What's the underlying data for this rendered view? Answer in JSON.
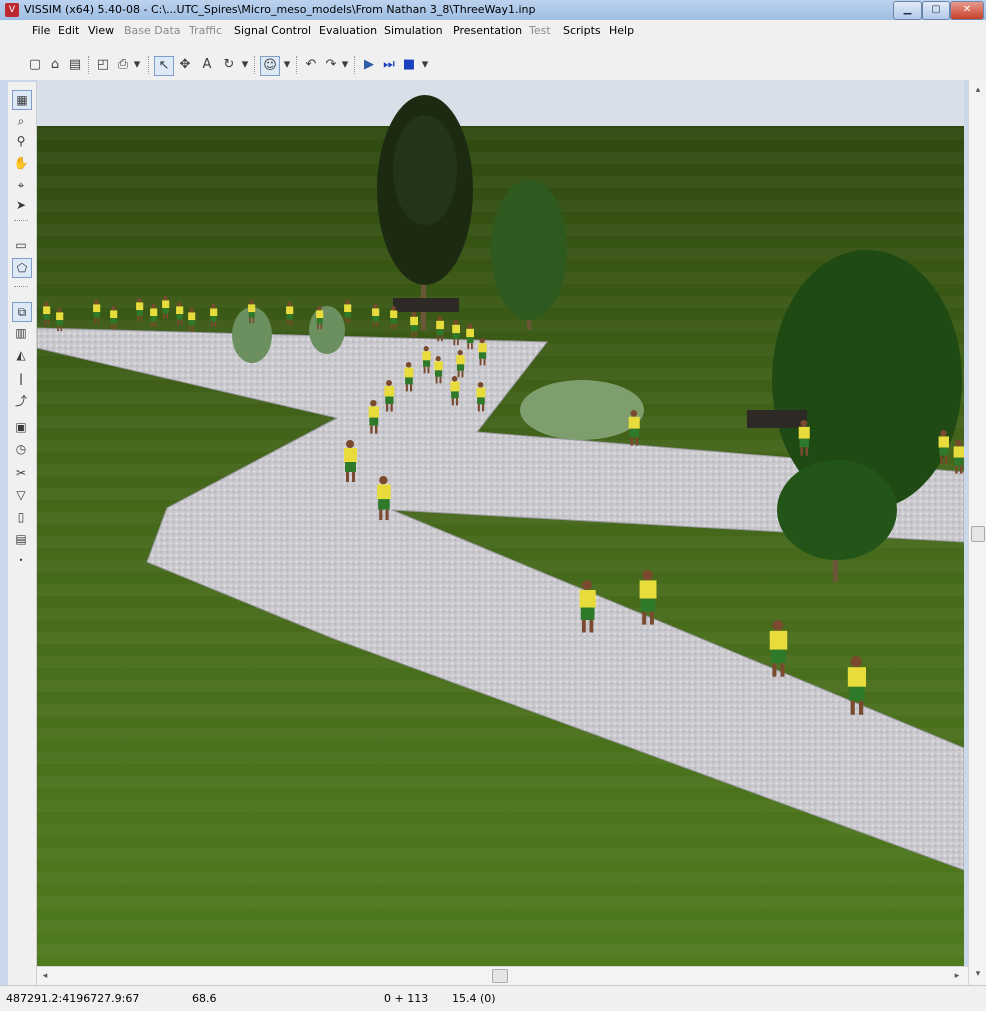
{
  "window": {
    "title": "VISSIM (x64) 5.40-08 - C:\\...UTC_Spires\\Micro_meso_models\\From Nathan 3_8\\ThreeWay1.inp",
    "controls": [
      "minimize",
      "maximize",
      "close"
    ]
  },
  "menu": [
    {
      "label": "File",
      "enabled": true
    },
    {
      "label": "Edit",
      "enabled": true
    },
    {
      "label": "View",
      "enabled": true
    },
    {
      "label": "Base Data",
      "enabled": false
    },
    {
      "label": "Traffic",
      "enabled": false
    },
    {
      "label": "Signal Control",
      "enabled": true
    },
    {
      "label": "Evaluation",
      "enabled": true
    },
    {
      "label": "Simulation",
      "enabled": true
    },
    {
      "label": "Presentation",
      "enabled": true
    },
    {
      "label": "Test",
      "enabled": false
    },
    {
      "label": "Scripts",
      "enabled": true
    },
    {
      "label": "Help",
      "enabled": true
    }
  ],
  "toolbar": {
    "buttons": [
      "new-icon",
      "open-icon",
      "save-icon",
      "print-preview-icon",
      "print-icon",
      "select-icon",
      "pan-icon",
      "text-icon",
      "rotate-icon",
      "pedestrian-icon",
      "undo-icon",
      "redo-icon",
      "play-icon",
      "single-step-icon",
      "stop-icon"
    ]
  },
  "left_tools": [
    "network-display-icon",
    "zoom-icon",
    "zoom-out-icon",
    "pan-hand-icon",
    "link-icon",
    "connector-icon",
    "area-icon",
    "ramp-icon",
    "obstacle-icon",
    "wall-icon",
    "signal-head-icon",
    "pedestrian-input-icon",
    "route-icon",
    "counter-icon",
    "clock-icon",
    "scissors-icon",
    "yield-icon",
    "signal-group-icon",
    "annotation-icon"
  ],
  "statusbar": {
    "coordinates": "487291.2:4196727.9:67",
    "zoom": "68.6",
    "time": "0 + 113",
    "speed": "15.4 (0)"
  },
  "colors": {
    "grass": "#4a6e1a",
    "path": "#c7c7cc",
    "shirt": "#e8dc3c",
    "shorts": "#2f7a2a",
    "sky": "#d7dee8"
  },
  "scene": {
    "pedestrians": 54,
    "trees": 4,
    "benches": 2,
    "signal_icon": "traffic-light-icon"
  }
}
